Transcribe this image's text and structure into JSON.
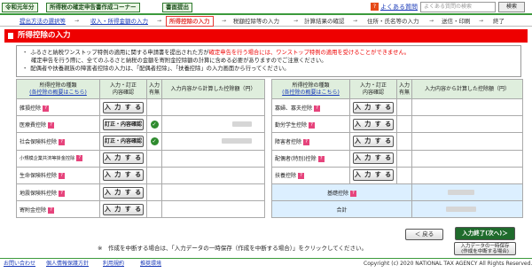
{
  "top": {
    "tags": [
      "令和元年分",
      "所得税の確定申告書作成コーナー",
      "書面提出"
    ],
    "faq": "よくある質問",
    "search_placeholder": "よくある質問の検索",
    "search_button": "検索"
  },
  "steps": [
    {
      "label": "提出方法の選択等",
      "state": "link"
    },
    {
      "label": "収入・所得金額の入力",
      "state": "link"
    },
    {
      "label": "所得控除の入力",
      "state": "active"
    },
    {
      "label": "税額控除等の入力",
      "state": "normal"
    },
    {
      "label": "計算結果の確認",
      "state": "normal"
    },
    {
      "label": "住所・氏名等の入力",
      "state": "normal"
    },
    {
      "label": "送信・印刷",
      "state": "normal"
    },
    {
      "label": "終了",
      "state": "normal"
    }
  ],
  "page_title": "所得控除の入力",
  "notice": {
    "line1_a": "ふるさと納税ワンストップ特例の適用に関する申請書を提出された方が",
    "line1_red": "確定申告を行う場合には、ワンストップ特例の適用を受けることができません。",
    "line2": "確定申告を行う際に、全てのふるさと納税の金額を寄附金控除額の計算に含める必要がありますのでご注意ください。",
    "line3": "配偶者や扶養親族の障害者控除の入力は、「配偶者控除」、「扶養控除」の入力画面から行ってください。"
  },
  "headers": {
    "kind": "所得控除の種類",
    "kind_link": "(各控除の概要はこちら)",
    "input": "入力・訂正\n内容確認",
    "has_input": "入力\n有無",
    "amount": "入力内容から計算した控除額（円）"
  },
  "left_rows": [
    {
      "name": "雑損控除",
      "button": "入 力 す る",
      "checked": false
    },
    {
      "name": "医療費控除",
      "button": "訂正・内容確認",
      "checked": true
    },
    {
      "name": "社会保険料控除",
      "button": "訂正・内容確認",
      "checked": true
    },
    {
      "name": "小規模企業共済等掛金控除",
      "button": "入 力 す る",
      "checked": false,
      "small": true
    },
    {
      "name": "生命保険料控除",
      "button": "入 力 す る",
      "checked": false
    },
    {
      "name": "地震保険料控除",
      "button": "入 力 す る",
      "checked": false
    },
    {
      "name": "寄附金控除",
      "button": "入 力 す る",
      "checked": false
    }
  ],
  "right_rows": [
    {
      "name": "寡婦、寡夫控除",
      "button": "入 力 す る"
    },
    {
      "name": "勤労学生控除",
      "button": "入 力 す る"
    },
    {
      "name": "障害者控除",
      "button": "入 力 す る"
    },
    {
      "name": "配偶者(特別)控除",
      "button": "入 力 す る"
    },
    {
      "name": "扶養控除",
      "button": "入 力 す る"
    }
  ],
  "basic_label": "基礎控除",
  "total_label": "合計",
  "footnote": "※　作成を中断する場合は、「入力データの一時保存（作成を中断する場合）」をクリックしてください。",
  "nav": {
    "back": "＜ 戻る",
    "next": "入力終了(次へ)＞",
    "save_line1": "入力データの一時保存",
    "save_line2": "(作成を中断する場合)"
  },
  "footer": {
    "links": [
      "お問い合わせ",
      "個人情報保護方針",
      "利用規約",
      "推奨環境"
    ],
    "copyright": "Copyright (c) 2020 NATIONAL TAX AGENCY All Rights Reserved."
  }
}
